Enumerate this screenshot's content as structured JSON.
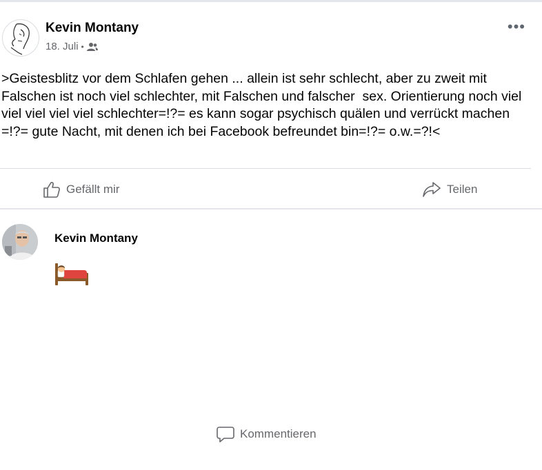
{
  "post": {
    "author": "Kevin Montany",
    "date": "18. Juli",
    "separator": "•",
    "audience_icon": "friends-icon",
    "more_icon": "more-options-icon",
    "more_glyph": "•••",
    "text": ">Geistesblitz vor dem Schlafen gehen ... allein ist sehr schlecht, aber zu zweit mit Falschen ist noch viel schlechter, mit Falschen und falscher  sex. Orientierung noch viel viel viel viel viel schlechter=!?= es kann sogar psychisch quälen und verrückt machen =!?= gute Nacht, mit denen ich bei Facebook befreundet bin=!?= o.w.=?!<"
  },
  "actions": {
    "like_label": "Gefällt mir",
    "comment_label": "Kommentieren",
    "share_label": "Teilen",
    "like_icon": "thumbs-up-icon",
    "comment_icon": "comment-bubble-icon",
    "share_icon": "share-arrow-icon"
  },
  "comment": {
    "author": "Kevin Montany",
    "emoji_icon": "bed-emoji-icon"
  },
  "colors": {
    "text": "#050505",
    "secondary": "#65676b",
    "divider": "#dadde1",
    "bed": "#e0443e"
  }
}
